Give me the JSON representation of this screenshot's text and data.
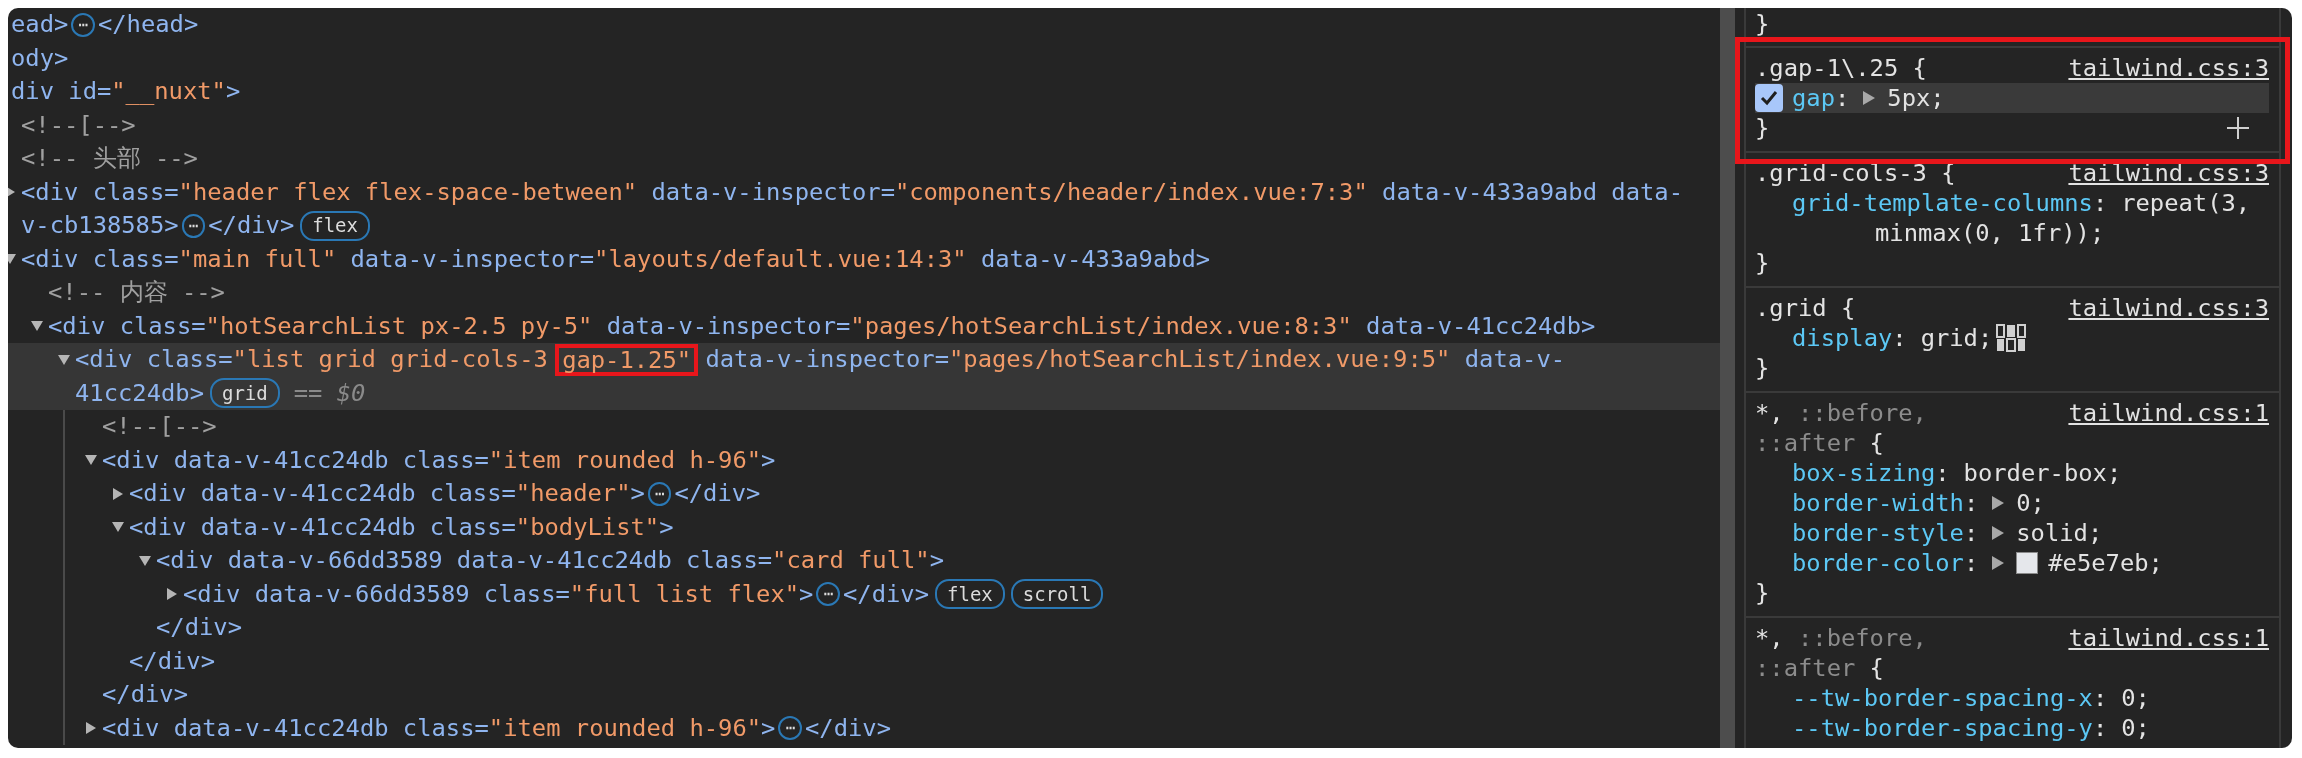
{
  "elements_panel": {
    "nodes": [
      {
        "selected": false,
        "lines": [
          [
            {
              "kind": "tag",
              "text": "ead>"
            },
            {
              "kind": "ellipsis",
              "text": "⋯"
            },
            {
              "kind": "tag",
              "text": "</head>"
            }
          ]
        ]
      },
      {
        "selected": false,
        "lines": [
          [
            {
              "kind": "tag",
              "text": "ody>"
            }
          ]
        ]
      },
      {
        "selected": false,
        "lines": [
          [
            {
              "kind": "tag",
              "text": "div"
            },
            {
              "kind": "attr",
              "text": " id="
            },
            {
              "kind": "value",
              "text": "\"__nuxt\""
            },
            {
              "kind": "tag",
              "text": ">"
            }
          ]
        ],
        "children": [
          {
            "selected": false,
            "lines": [
              [
                {
                  "kind": "comment",
                  "text": "<!--[-->"
                }
              ]
            ]
          },
          {
            "selected": false,
            "lines": [
              [
                {
                  "kind": "comment",
                  "text": "<!-- 头部 -->"
                }
              ]
            ]
          },
          {
            "selected": false,
            "expanded": false,
            "lines": [
              [
                {
                  "kind": "tag",
                  "text": "<div"
                },
                {
                  "kind": "attr",
                  "text": " class="
                },
                {
                  "kind": "value",
                  "text": "\"header flex flex-space-between\""
                },
                {
                  "kind": "attr",
                  "text": " data-v-inspector="
                },
                {
                  "kind": "value",
                  "text": "\"components/header/index.vue:7:3\""
                },
                {
                  "kind": "attr",
                  "text": " data-v-433a9abd data-"
                }
              ],
              [
                {
                  "kind": "attr",
                  "text": "v-cb138585"
                },
                {
                  "kind": "tag",
                  "text": ">"
                },
                {
                  "kind": "ellipsis",
                  "text": "⋯"
                },
                {
                  "kind": "tag",
                  "text": "</div>"
                },
                {
                  "kind": "badge",
                  "text": "flex"
                }
              ]
            ]
          },
          {
            "selected": false,
            "expanded": true,
            "lines": [
              [
                {
                  "kind": "tag",
                  "text": "<div"
                },
                {
                  "kind": "attr",
                  "text": " class="
                },
                {
                  "kind": "value",
                  "text": "\"main full\""
                },
                {
                  "kind": "attr",
                  "text": " data-v-inspector="
                },
                {
                  "kind": "value",
                  "text": "\"layouts/default.vue:14:3\""
                },
                {
                  "kind": "attr",
                  "text": " data-v-433a9abd"
                },
                {
                  "kind": "tag",
                  "text": ">"
                }
              ]
            ],
            "children": [
              {
                "selected": false,
                "lines": [
                  [
                    {
                      "kind": "comment",
                      "text": "<!-- 内容 -->"
                    }
                  ]
                ]
              },
              {
                "selected": false,
                "expanded": true,
                "lines": [
                  [
                    {
                      "kind": "tag",
                      "text": "<div"
                    },
                    {
                      "kind": "attr",
                      "text": " class="
                    },
                    {
                      "kind": "value",
                      "text": "\"hotSearchList px-2.5 py-5\""
                    },
                    {
                      "kind": "attr",
                      "text": " data-v-inspector="
                    },
                    {
                      "kind": "value",
                      "text": "\"pages/hotSearchList/index.vue:8:3\""
                    },
                    {
                      "kind": "attr",
                      "text": " data-v-41cc24db"
                    },
                    {
                      "kind": "tag",
                      "text": ">"
                    }
                  ]
                ],
                "children": [
                  {
                    "selected": true,
                    "expanded": true,
                    "lines": [
                      [
                        {
                          "kind": "tag",
                          "text": "<div"
                        },
                        {
                          "kind": "attr",
                          "text": " class="
                        },
                        {
                          "kind": "value",
                          "text": "\"list grid grid-cols-3 "
                        },
                        {
                          "kind": "value",
                          "text": "gap-1.25\"",
                          "annotated": true
                        },
                        {
                          "kind": "attr",
                          "text": " data-v-inspector="
                        },
                        {
                          "kind": "value",
                          "text": "\"pages/hotSearchList/index.vue:9:5\""
                        },
                        {
                          "kind": "attr",
                          "text": " data-v-"
                        }
                      ],
                      [
                        {
                          "kind": "attr",
                          "text": "41cc24db"
                        },
                        {
                          "kind": "tag",
                          "text": ">"
                        },
                        {
                          "kind": "badge",
                          "text": "grid"
                        },
                        {
                          "kind": "ref",
                          "text": "== *$0*"
                        }
                      ]
                    ],
                    "children": [
                      {
                        "selected": false,
                        "lines": [
                          [
                            {
                              "kind": "comment",
                              "text": "<!--[-->"
                            }
                          ]
                        ]
                      },
                      {
                        "selected": false,
                        "expanded": true,
                        "lines": [
                          [
                            {
                              "kind": "tag",
                              "text": "<div"
                            },
                            {
                              "kind": "attr",
                              "text": " data-v-41cc24db class="
                            },
                            {
                              "kind": "value",
                              "text": "\"item rounded h-96\""
                            },
                            {
                              "kind": "tag",
                              "text": ">"
                            }
                          ]
                        ],
                        "children": [
                          {
                            "selected": false,
                            "expanded": false,
                            "lines": [
                              [
                                {
                                  "kind": "tag",
                                  "text": "<div"
                                },
                                {
                                  "kind": "attr",
                                  "text": " data-v-41cc24db class="
                                },
                                {
                                  "kind": "value",
                                  "text": "\"header\""
                                },
                                {
                                  "kind": "tag",
                                  "text": ">"
                                },
                                {
                                  "kind": "ellipsis",
                                  "text": "⋯"
                                },
                                {
                                  "kind": "tag",
                                  "text": "</div>"
                                }
                              ]
                            ]
                          },
                          {
                            "selected": false,
                            "expanded": true,
                            "lines": [
                              [
                                {
                                  "kind": "tag",
                                  "text": "<div"
                                },
                                {
                                  "kind": "attr",
                                  "text": " data-v-41cc24db class="
                                },
                                {
                                  "kind": "value",
                                  "text": "\"bodyList\""
                                },
                                {
                                  "kind": "tag",
                                  "text": ">"
                                }
                              ]
                            ],
                            "children": [
                              {
                                "selected": false,
                                "expanded": true,
                                "lines": [
                                  [
                                    {
                                      "kind": "tag",
                                      "text": "<div"
                                    },
                                    {
                                      "kind": "attr",
                                      "text": " data-v-66dd3589 data-v-41cc24db class="
                                    },
                                    {
                                      "kind": "value",
                                      "text": "\"card full\""
                                    },
                                    {
                                      "kind": "tag",
                                      "text": ">"
                                    }
                                  ]
                                ],
                                "children": [
                                  {
                                    "selected": false,
                                    "expanded": false,
                                    "lines": [
                                      [
                                        {
                                          "kind": "tag",
                                          "text": "<div"
                                        },
                                        {
                                          "kind": "attr",
                                          "text": " data-v-66dd3589 class="
                                        },
                                        {
                                          "kind": "value",
                                          "text": "\"full list flex\""
                                        },
                                        {
                                          "kind": "tag",
                                          "text": ">"
                                        },
                                        {
                                          "kind": "ellipsis",
                                          "text": "⋯"
                                        },
                                        {
                                          "kind": "tag",
                                          "text": "</div>"
                                        },
                                        {
                                          "kind": "badge",
                                          "text": "flex"
                                        },
                                        {
                                          "kind": "badge",
                                          "text": "scroll"
                                        }
                                      ]
                                    ]
                                  }
                                ],
                                "close": "</div>"
                              }
                            ],
                            "close": "</div>"
                          }
                        ],
                        "close": "</div>"
                      },
                      {
                        "selected": false,
                        "expanded": false,
                        "lines": [
                          [
                            {
                              "kind": "tag",
                              "text": "<div"
                            },
                            {
                              "kind": "attr",
                              "text": " data-v-41cc24db class="
                            },
                            {
                              "kind": "value",
                              "text": "\"item rounded h-96\""
                            },
                            {
                              "kind": "tag",
                              "text": ">"
                            },
                            {
                              "kind": "ellipsis",
                              "text": "⋯"
                            },
                            {
                              "kind": "tag",
                              "text": "</div>"
                            }
                          ]
                        ]
                      }
                    ]
                  }
                ]
              }
            ]
          }
        ]
      }
    ]
  },
  "styles_panel": {
    "rules": [
      {
        "annotated": false,
        "close": "}"
      },
      {
        "annotated": true,
        "add_button": true,
        "selector_lines": [
          [
            {
              "text": ".gap-1\\.25",
              "matched": true
            },
            {
              "text": " {",
              "matched": true
            }
          ]
        ],
        "source": "tailwind.css:3",
        "properties": [
          {
            "name": "gap",
            "colon": ":",
            "expandable": true,
            "checked": true,
            "highlighted": true,
            "value": [
              "5px;"
            ]
          }
        ],
        "close": "}"
      },
      {
        "annotated": false,
        "selector_lines": [
          [
            {
              "text": ".grid-cols-3",
              "matched": true
            },
            {
              "text": " {",
              "matched": true
            }
          ]
        ],
        "source": "tailwind.css:3",
        "properties": [
          {
            "name": "grid-template-columns",
            "colon": ":",
            "value": [
              "repeat(3,",
              "minmax(0, 1fr));"
            ]
          }
        ],
        "close": "}"
      },
      {
        "annotated": false,
        "selector_lines": [
          [
            {
              "text": ".grid",
              "matched": true
            },
            {
              "text": " {",
              "matched": true
            }
          ]
        ],
        "source": "tailwind.css:3",
        "properties": [
          {
            "kind": "grid",
            "name": "display",
            "colon": ":",
            "value": [
              "grid;"
            ]
          }
        ],
        "close": "}"
      },
      {
        "annotated": false,
        "selector_lines": [
          [
            {
              "text": "*,",
              "matched": true
            },
            {
              "text": " ::before,",
              "matched": false
            }
          ],
          [
            {
              "text": "::after",
              "matched": false
            },
            {
              "text": " {",
              "matched": true
            }
          ]
        ],
        "source": "tailwind.css:1",
        "properties": [
          {
            "name": "box-sizing",
            "colon": ":",
            "value": [
              "border-box;"
            ]
          },
          {
            "name": "border-width",
            "colon": ":",
            "expandable": true,
            "value": [
              "0;"
            ]
          },
          {
            "name": "border-style",
            "colon": ":",
            "expandable": true,
            "value": [
              "solid;"
            ]
          },
          {
            "name": "border-color",
            "colon": ":",
            "expandable": true,
            "color": "#e5e7eb",
            "value": [
              "#e5e7eb;"
            ]
          }
        ],
        "close": "}"
      },
      {
        "annotated": false,
        "selector_lines": [
          [
            {
              "text": "*,",
              "matched": true
            },
            {
              "text": " ::before,",
              "matched": false
            }
          ],
          [
            {
              "text": "::after",
              "matched": false
            },
            {
              "text": " {",
              "matched": true
            }
          ]
        ],
        "source": "tailwind.css:1",
        "properties": [
          {
            "name": "--tw-border-spacing-x",
            "colon": ":",
            "value": [
              "0;"
            ]
          },
          {
            "name": "--tw-border-spacing-y",
            "colon": ":",
            "value": [
              "0;"
            ]
          }
        ]
      }
    ]
  }
}
